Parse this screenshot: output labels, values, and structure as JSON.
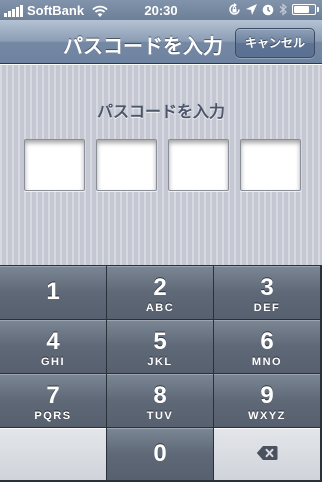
{
  "status_bar": {
    "carrier": "SoftBank",
    "time": "20:30",
    "icons": [
      "signal-bars-icon",
      "wifi-icon",
      "rotation-lock-icon",
      "location-icon",
      "alarm-clock-icon",
      "bluetooth-icon",
      "battery-icon"
    ],
    "battery_level": 0.82
  },
  "nav_bar": {
    "title": "パスコードを入力",
    "cancel_label": "キャンセル"
  },
  "passcode": {
    "prompt": "パスコードを入力",
    "boxes": [
      "",
      "",
      "",
      ""
    ]
  },
  "keypad": {
    "keys": [
      {
        "digit": "1",
        "letters": ""
      },
      {
        "digit": "2",
        "letters": "ABC"
      },
      {
        "digit": "3",
        "letters": "DEF"
      },
      {
        "digit": "4",
        "letters": "GHI"
      },
      {
        "digit": "5",
        "letters": "JKL"
      },
      {
        "digit": "6",
        "letters": "MNO"
      },
      {
        "digit": "7",
        "letters": "PQRS"
      },
      {
        "digit": "8",
        "letters": "TUV"
      },
      {
        "digit": "9",
        "letters": "WXYZ"
      },
      {
        "digit": "",
        "letters": ""
      },
      {
        "digit": "0",
        "letters": ""
      },
      {
        "digit": "",
        "letters": ""
      }
    ],
    "delete_icon": "backspace-icon"
  },
  "colors": {
    "nav_bar": "#7589a5",
    "content_background": "#c9ccd6",
    "key_dark": "#5e6876",
    "key_light": "#d8dbe0"
  }
}
